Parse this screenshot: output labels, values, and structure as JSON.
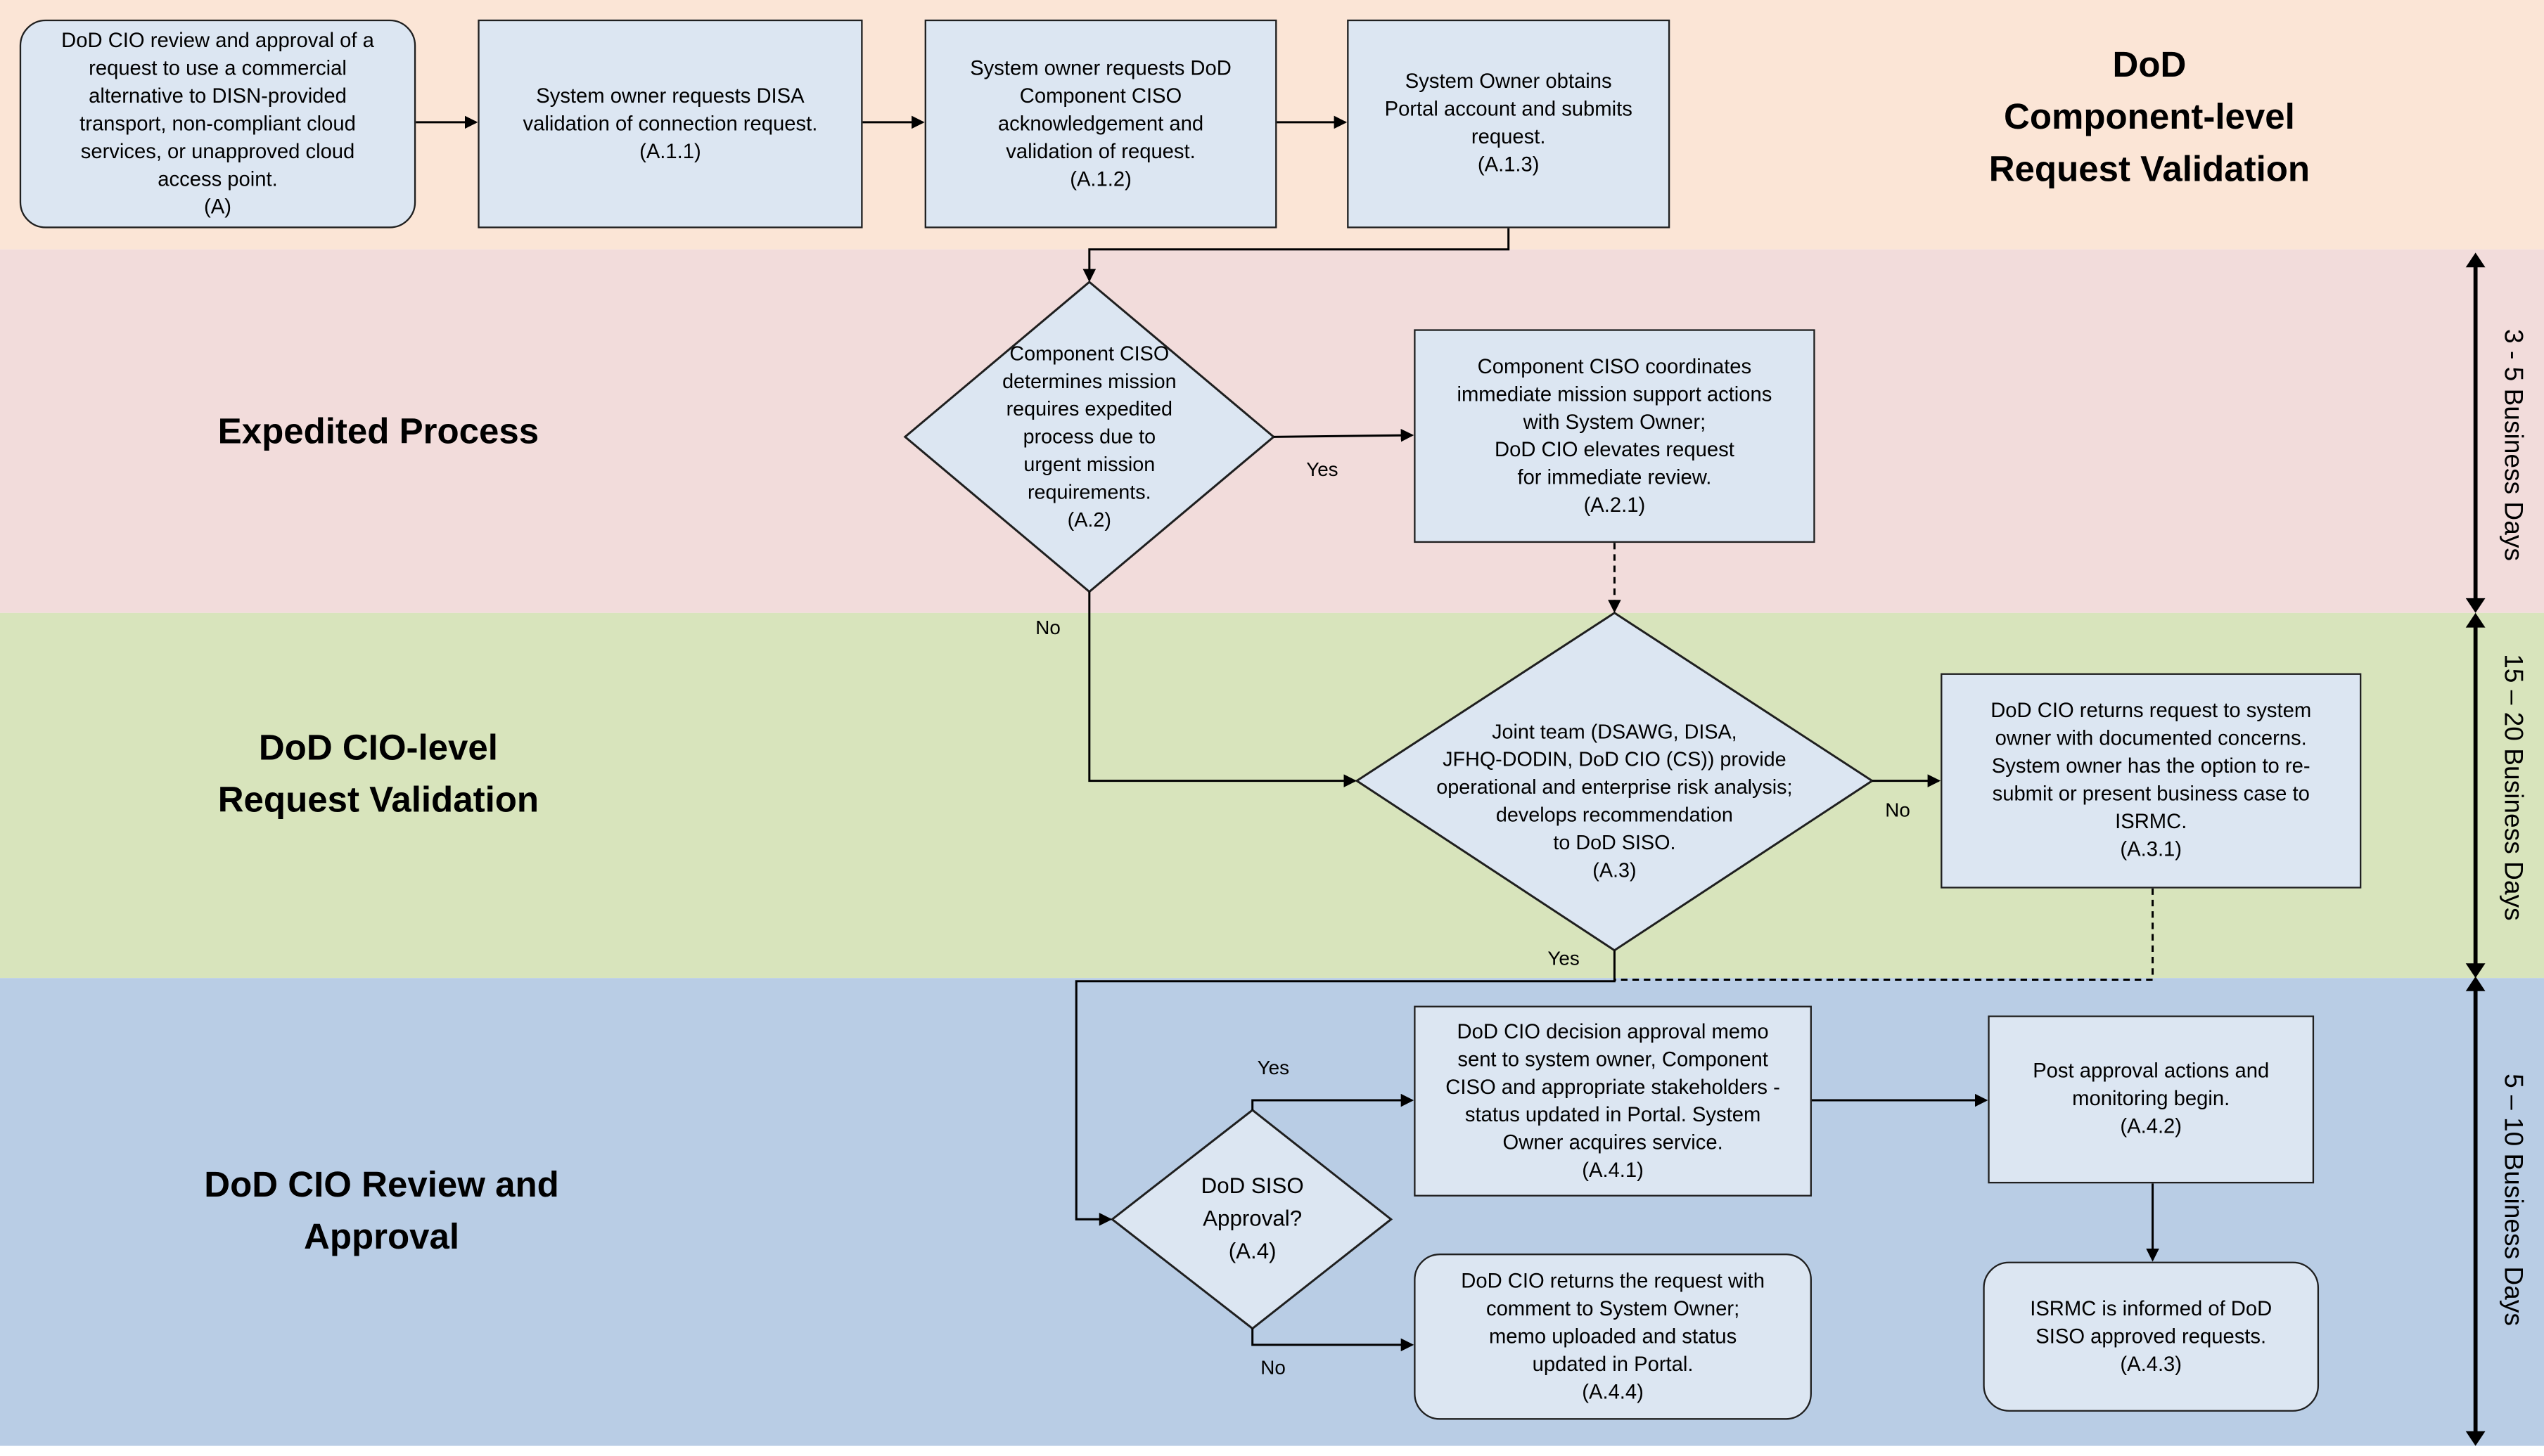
{
  "colors": {
    "lane_component": "#fbe5d6",
    "lane_expedited": "#f2dcdb",
    "lane_cio_validation": "#d8e4bc",
    "lane_review": "#b9cde5",
    "box_fill": "#dce6f2"
  },
  "lanes": [
    {
      "title": "DoD\nComponent-level\nRequest Validation"
    },
    {
      "title": "Expedited Process"
    },
    {
      "title": "DoD CIO-level\nRequest Validation"
    },
    {
      "title": "DoD CIO Review and\nApproval"
    }
  ],
  "durations": [
    "3 - 5 Business Days",
    "15 – 20  Business Days",
    "5 – 10 Business Days"
  ],
  "steps": {
    "A": "DoD CIO review and approval of a\nrequest  to use a commercial\nalternative to DISN-provided\ntransport, non-compliant cloud\nservices, or unapproved cloud\naccess point.\n(A)",
    "A11": "System owner requests DISA\nvalidation of connection request.\n(A.1.1)",
    "A12": "System owner requests DoD\nComponent CISO\nacknowledgement and\nvalidation of request.\n(A.1.2)",
    "A13": "System Owner obtains\nPortal account and submits\nrequest.\n(A.1.3)",
    "A2": "Component CISO\ndetermines mission\nrequires expedited\nprocess due to\nurgent mission\nrequirements.\n(A.2)",
    "A21": "Component CISO coordinates\nimmediate mission support actions\nwith System Owner;\nDoD CIO elevates request\nfor immediate review.\n(A.2.1)",
    "A3": "Joint team (DSAWG, DISA,\nJFHQ-DODIN, DoD CIO (CS)) provide\noperational and enterprise risk analysis;\ndevelops recommendation\nto DoD SISO.\n(A.3)",
    "A31": "DoD CIO returns request to system\nowner with documented concerns.\nSystem owner has the option to re-\nsubmit or present business case to\nISRMC.\n(A.3.1)",
    "A4": "DoD SISO\nApproval?\n(A.4)",
    "A41": "DoD CIO decision approval memo\nsent to system owner, Component\nCISO and appropriate stakeholders -\nstatus updated in Portal. System\nOwner acquires service.\n(A.4.1)",
    "A42": "Post approval actions and\nmonitoring begin.\n(A.4.2)",
    "A43": "ISRMC is informed of DoD\nSISO approved requests.\n(A.4.3)",
    "A44": "DoD CIO returns the request with\ncomment to System Owner;\nmemo uploaded and status\nupdated in Portal.\n(A.4.4)"
  },
  "branch_labels": {
    "a2_yes": "Yes",
    "a2_no": "No",
    "a3_no": "No",
    "a3_yes": "Yes",
    "a4_yes": "Yes",
    "a4_no": "No"
  }
}
